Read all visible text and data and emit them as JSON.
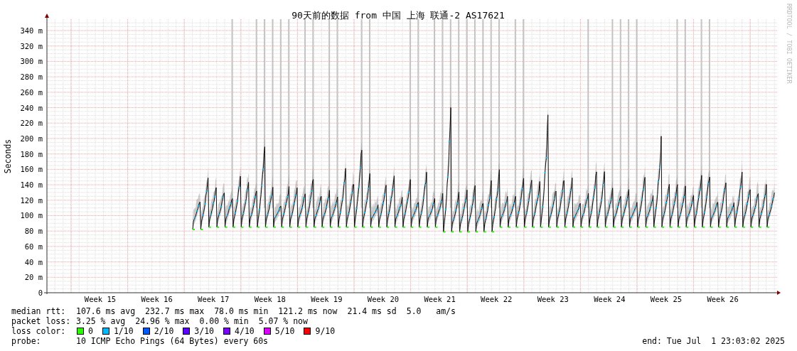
{
  "title": "90天前的数据 from 中国 上海 联通-2 AS17621",
  "credit": "RRDTOOL / TOBI OETIKER",
  "y_axis": {
    "label": "Seconds",
    "ticks": [
      "340 m",
      "320 m",
      "300 m",
      "280 m",
      "260 m",
      "240 m",
      "220 m",
      "200 m",
      "180 m",
      "160 m",
      "140 m",
      "120 m",
      "100 m",
      "80 m",
      "60 m",
      "40 m",
      "20 m",
      "0"
    ]
  },
  "x_axis": {
    "ticks": [
      "Week 15",
      "Week 16",
      "Week 17",
      "Week 18",
      "Week 19",
      "Week 20",
      "Week 21",
      "Week 22",
      "Week 23",
      "Week 24",
      "Week 25",
      "Week 26"
    ]
  },
  "stats": [
    {
      "label": "median rtt:",
      "values": [
        "107.6 ms avg",
        "232.7 ms max",
        "78.0 ms min",
        "121.2 ms now",
        "21.4 ms sd",
        "5.0   am/s"
      ]
    },
    {
      "label": "packet loss:",
      "values": [
        "3.25 % avg",
        "24.96 % max",
        "0.00 % min",
        "5.07 % now"
      ]
    }
  ],
  "loss_colors": {
    "label": "loss color:",
    "items": [
      {
        "label": "0",
        "color": "#26ff00"
      },
      {
        "label": "1/10",
        "color": "#00b8ff"
      },
      {
        "label": "2/10",
        "color": "#0059ff"
      },
      {
        "label": "3/10",
        "color": "#5e00ff"
      },
      {
        "label": "4/10",
        "color": "#7e00ff"
      },
      {
        "label": "5/10",
        "color": "#dd00ff"
      },
      {
        "label": "9/10",
        "color": "#ff0000"
      }
    ]
  },
  "probe": {
    "label": "probe:",
    "text": "10 ICMP Echo Pings (64 Bytes) every 60s"
  },
  "end": "end: Tue Jul  1 23:03:02 2025"
}
